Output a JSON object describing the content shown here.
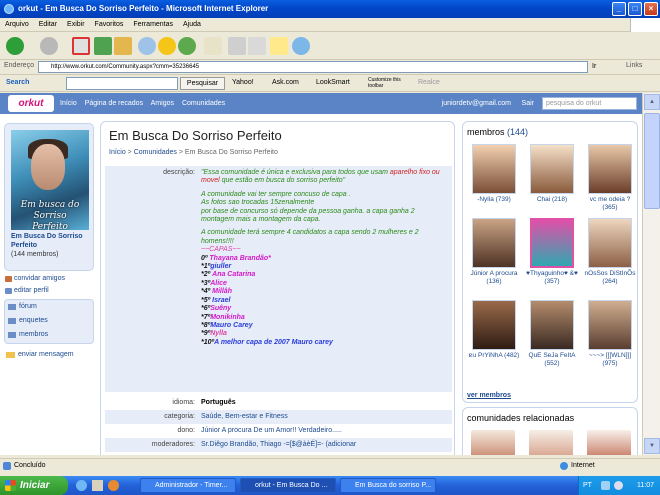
{
  "window": {
    "title": "orkut - Em Busca Do Sorriso Perfeito - Microsoft Internet Explorer"
  },
  "menu": [
    "Arquivo",
    "Editar",
    "Exibir",
    "Favoritos",
    "Ferramentas",
    "Ajuda"
  ],
  "address": {
    "label": "Endereço",
    "url": "http://www.orkut.com/Community.aspx?cmm=35236645",
    "go": "Ir",
    "links": "Links"
  },
  "msnbar": {
    "search_label": "Search",
    "search_button": "Pesquisar",
    "items": [
      "Yahoo!",
      "Ask.com",
      "LookSmart",
      "Customize this toolbar",
      "Realce"
    ]
  },
  "orkut": {
    "logo": "orkut",
    "nav": [
      "Início",
      "Página de recados",
      "Amigos",
      "Comunidades"
    ],
    "account": "juniordetv@gmail.com",
    "logout": "Sair",
    "search_placeholder": "pesquisa do orkut"
  },
  "community": {
    "photo_caption": "Em busca do Sorriso Perfeito",
    "name": "Em Busca Do Sorriso Perfeito",
    "members_count": "(144 membros)",
    "actions": [
      "convidar amigos",
      "editar perfil"
    ],
    "menu": [
      "fórum",
      "enquetes",
      "membros"
    ],
    "send_message": "enviar mensagem",
    "title": "Em Busca Do Sorriso Perfeito",
    "breadcrumb": [
      "Início",
      "Comunidades",
      "Em Busca Do Sorriso Perfeito"
    ],
    "desc_label": "descrição:",
    "desc": {
      "p1a": "\"Essa comunidade é única e exclusiva para todos que usam",
      "p1b": "aparelho fixo ou movel",
      "p1c": "que estão em busca do sorriso perfeito\"",
      "p2": "A comunidade vai ter sempre concuso de capa .",
      "p3": "As fotos sao trocadas 15zenalmente",
      "p4": "por base de concurso só depende da pessoa ganha. a capa ganha 2 montagem mais a montagem da capa.",
      "p5": "A comunidade terá sempre 4 candidatos a capa sendo 2 mulheres e 2 homens!!!!",
      "capas": "~~CAPAS~~",
      "list": [
        {
          "n": "0º",
          "t": "Thayana Brandão*"
        },
        {
          "n": "*1º",
          "t": "giuller"
        },
        {
          "n": "*2º",
          "t": "Ana Catarina"
        },
        {
          "n": "*3º",
          "t": "Alice"
        },
        {
          "n": "*4º",
          "t": "Millâh"
        },
        {
          "n": "*5º",
          "t": "Israel"
        },
        {
          "n": "*6º",
          "t": "Suêny"
        },
        {
          "n": "*7º",
          "t": "Monikinha"
        },
        {
          "n": "*8º",
          "t": "Mauro Carey"
        },
        {
          "n": "*9º",
          "t": "Nylla"
        },
        {
          "n": "*10º",
          "t": "A melhor capa de 2007 Mauro carey"
        }
      ]
    },
    "fields": [
      {
        "label": "idioma:",
        "value": "Português"
      },
      {
        "label": "categoria:",
        "value": "Saúde, Bem-estar e Fitness"
      },
      {
        "label": "dono:",
        "value": "Júnior A procura De um Amor!! Verdadeiro....."
      },
      {
        "label": "moderadores:",
        "value": "Sr.Diêgo Brandão, Thiago -=[$@àèÉ]=- (adicionar"
      }
    ]
  },
  "members_box": {
    "title": "membros",
    "count": "(144)",
    "members": [
      "-Nylla (739)",
      "Chai (218)",
      "vc me odeia ? (365)",
      "Júnior A procura (136)",
      "♥Thyaguinho♥ &♥ (357)",
      "nOsSos DiStInÕs (264)",
      "ɐıɹ PrYiNhA (482)",
      "QuE SeJa FeItA (552)",
      "~~~> [[[WLN]]] (975)"
    ],
    "see_all": "ver membros"
  },
  "related": {
    "title": "comunidades relacionadas"
  },
  "status": {
    "text": "Concluído",
    "zone": "Internet"
  },
  "taskbar": {
    "start": "Iniciar",
    "tasks": [
      "Administrador - Timer...",
      "orkut - Em Busca Do ...",
      "Em Busca do sorriso P..."
    ],
    "lang": "PT",
    "clock": "11:07"
  },
  "colors": {
    "orkut_blue": "#5A84C6",
    "light_blue": "#E6EDF9",
    "xp_title": "#0247C8"
  }
}
